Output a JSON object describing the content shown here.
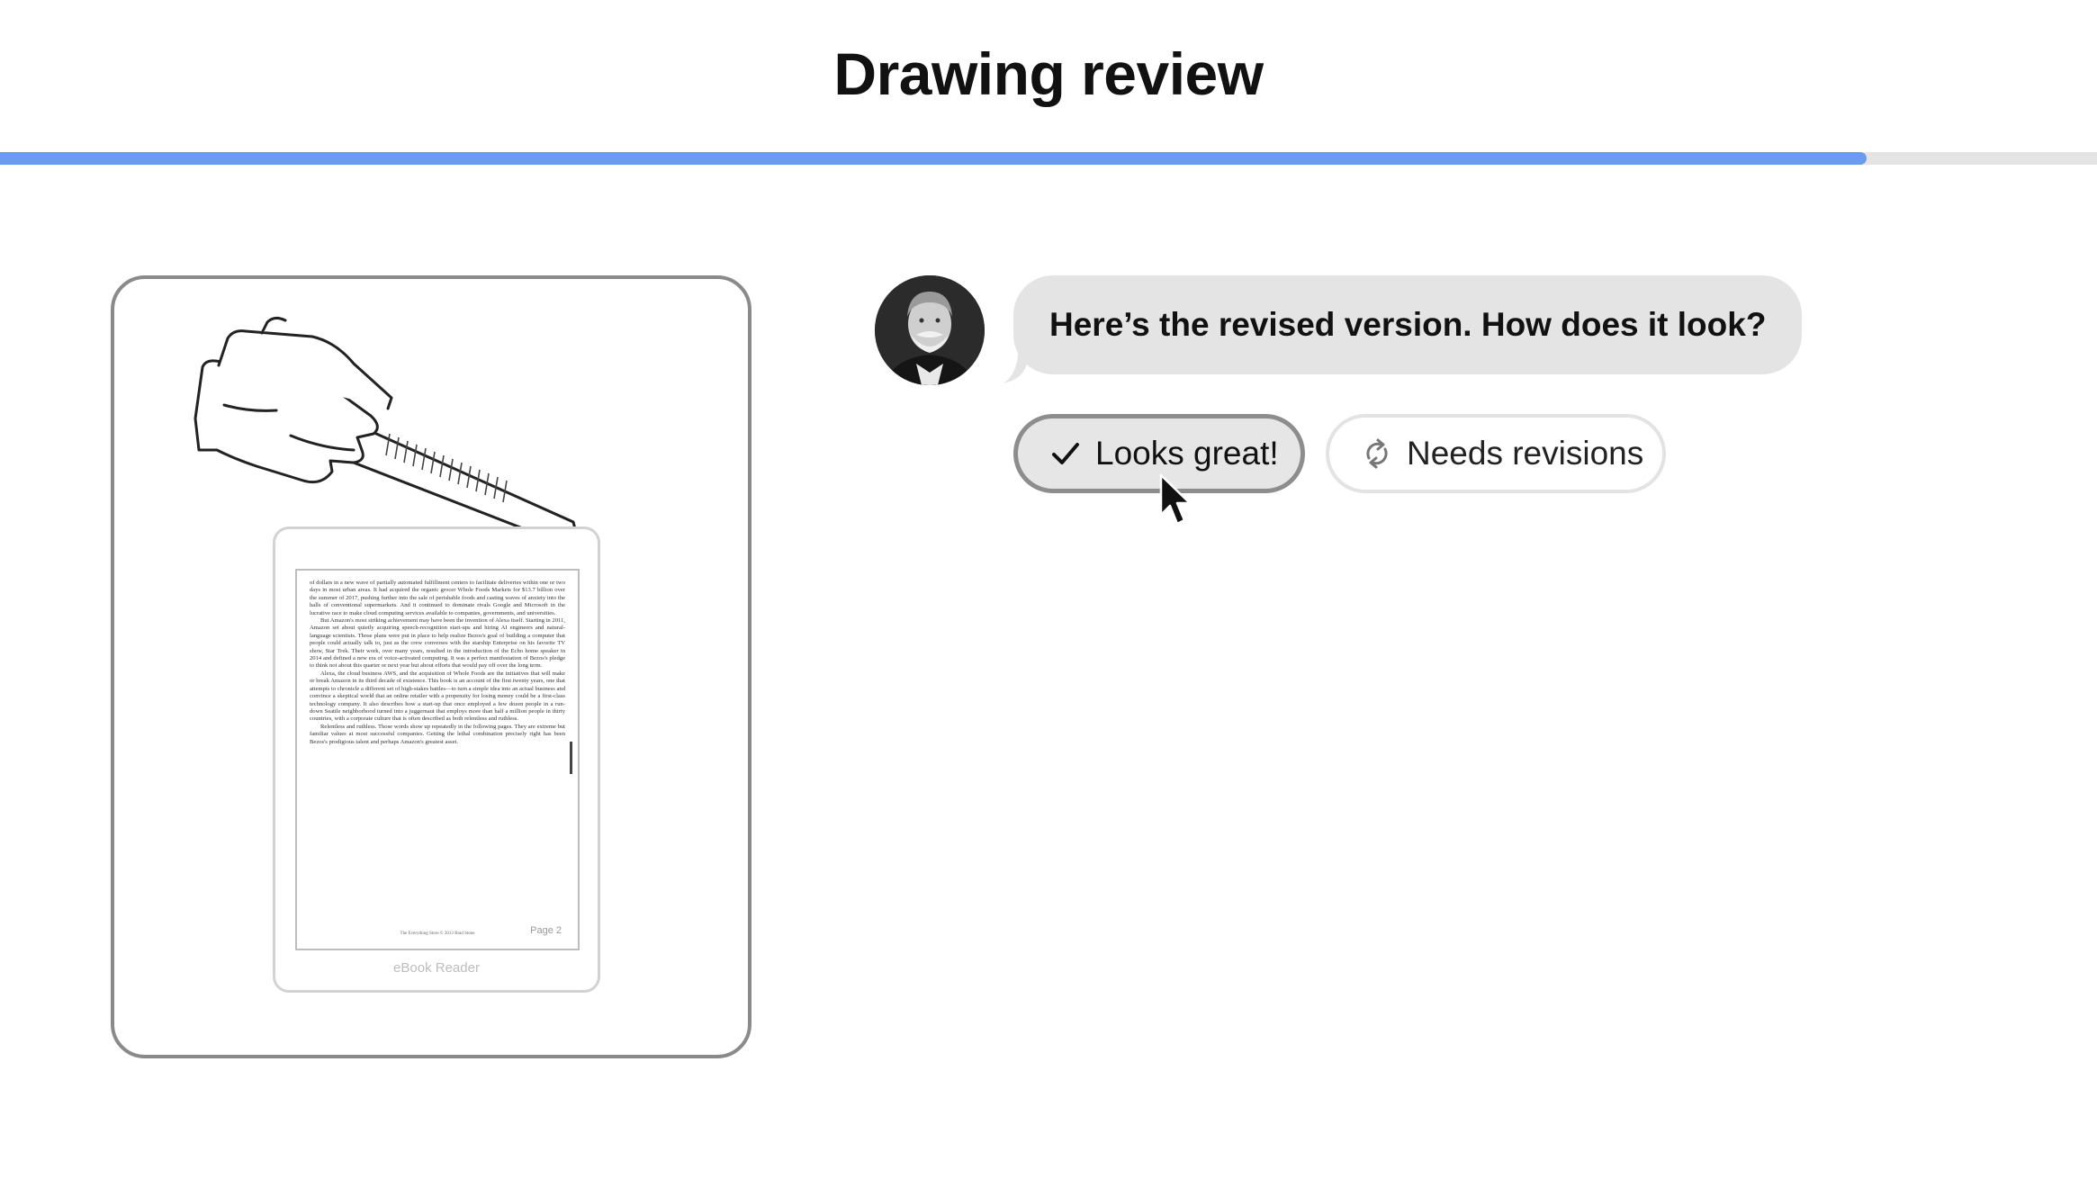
{
  "header": {
    "title": "Drawing review"
  },
  "progress": {
    "fraction": 0.89,
    "fill_color": "#6a9bf0",
    "track_color": "#e4e4e4"
  },
  "drawing": {
    "page_text": [
      "of dollars in a new wave of partially automated fulfillment centers to facilitate deliveries within one or two days in most urban areas. It had acquired the organic grocer Whole Foods Markets for $13.7 billion over the summer of 2017, pushing further into the sale of perishable foods and casting waves of anxiety into the halls of conventional supermarkets. And it continued to dominate rivals Google and Microsoft in the lucrative race to make cloud computing services available to companies, governments, and universities.",
      "But Amazon's most striking achievement may have been the invention of Alexa itself. Starting in 2011, Amazon set about quietly acquiring speech-recognition start-ups and hiring AI engineers and natural-language scientists. Those plans were put in place to help realize Bezos's goal of building a computer that people could actually talk to, just as the crew converses with the starship Enterprise on his favorite TV show, Star Trek. Their work, over many years, resulted in the introduction of the Echo home speaker in 2014 and defined a new era of voice-activated computing. It was a perfect manifestation of Bezos's pledge to think not about this quarter or next year but about efforts that would pay off over the long term.",
      "Alexa, the cloud business AWS, and the acquisition of Whole Foods are the initiatives that will make or break Amazon in its third decade of existence. This book is an account of the first twenty years, one that attempts to chronicle a different set of high-stakes battles—to turn a simple idea into an actual business and convince a skeptical world that an online retailer with a propensity for losing money could be a first-class technology company. It also describes how a start-up that once employed a few dozen people in a run-down Seattle neighborhood turned into a juggernaut that employs more than half a million people in thirty countries, with a corporate culture that is often described as both relentless and ruthless.",
      "Relentless and ruthless. Those words show up repeatedly in the following pages. They are extreme but familiar values at most successful companies. Getting the lethal combination precisely right has been Bezos's prodigious talent and perhaps Amazon's greatest asset."
    ],
    "page_footer": "The Everything Store © 2013 Brad Stone",
    "page_number": "Page 2",
    "device_label": "eBook Reader"
  },
  "chat": {
    "message": "Here’s the revised version. How does it look?"
  },
  "actions": {
    "approve_label": "Looks great!",
    "revise_label": "Needs revisions",
    "approve_icon": "check-icon",
    "revise_icon": "refresh-icon"
  }
}
